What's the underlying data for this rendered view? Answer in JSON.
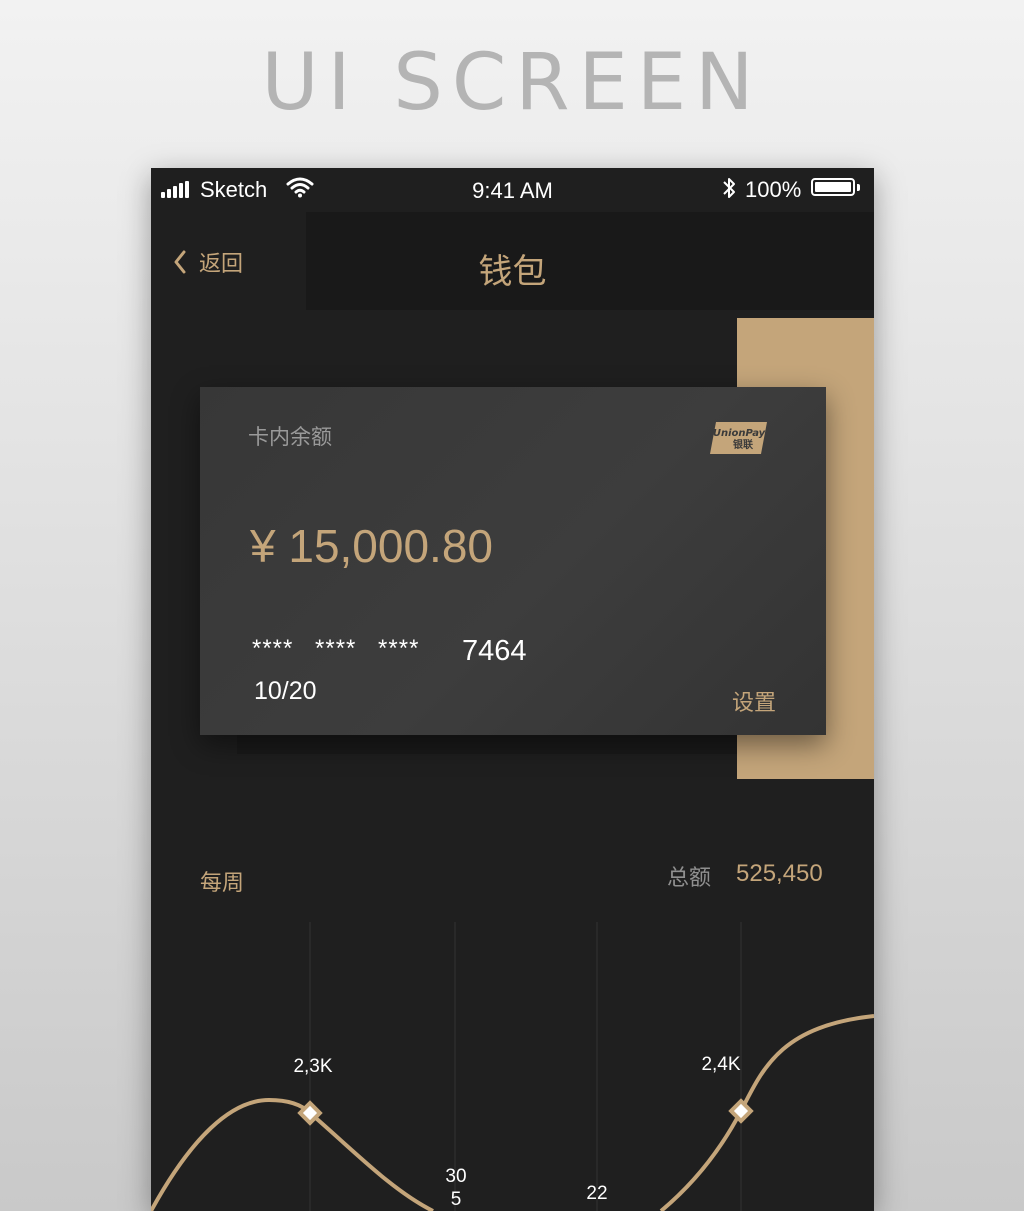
{
  "page": {
    "heading": "UI SCREEN"
  },
  "status_bar": {
    "carrier": "Sketch",
    "time": "9:41 AM",
    "battery_percent": "100%"
  },
  "nav": {
    "back_label": "返回",
    "title": "钱包"
  },
  "card": {
    "balance_label": "卡内余额",
    "balance": "¥ 15,000.80",
    "masked_number": "**** **** ****",
    "last4": "7464",
    "expiry": "10/20",
    "settings_label": "设置",
    "brand_line1": "UnionPay",
    "brand_line2": "银联"
  },
  "summary": {
    "period_label": "每周",
    "total_label": "总额",
    "total_value": "525,450"
  },
  "colors": {
    "accent": "#c4a57a",
    "background": "#1f1f1f",
    "card": "#3a3a3a"
  },
  "chart_data": {
    "type": "line",
    "points": [
      {
        "label": "2,3K"
      },
      {
        "label": "30"
      },
      {
        "label": "5"
      },
      {
        "label": "22"
      },
      {
        "label": "2,4K"
      }
    ]
  }
}
